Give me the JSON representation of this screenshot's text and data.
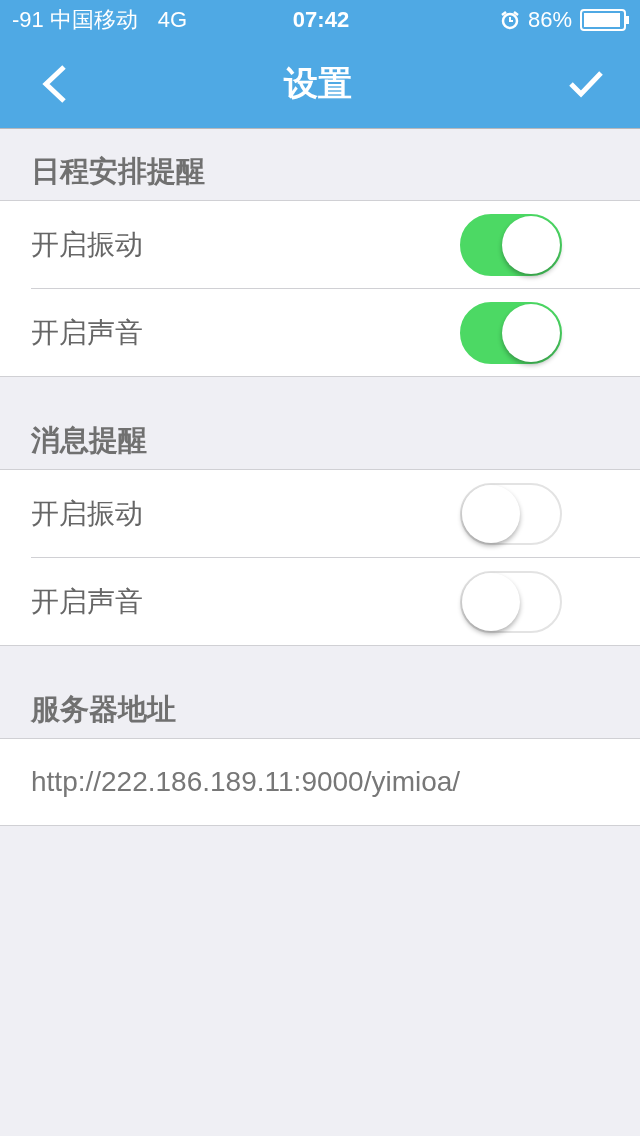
{
  "status_bar": {
    "signal": "-91",
    "carrier": "中国移动",
    "network": "4G",
    "time": "07:42",
    "battery": "86%"
  },
  "nav": {
    "title": "设置"
  },
  "sections": [
    {
      "title": "日程安排提醒",
      "rows": [
        {
          "label": "开启振动",
          "on": true
        },
        {
          "label": "开启声音",
          "on": true
        }
      ]
    },
    {
      "title": "消息提醒",
      "rows": [
        {
          "label": "开启振动",
          "on": false
        },
        {
          "label": "开启声音",
          "on": false
        }
      ]
    }
  ],
  "server": {
    "title": "服务器地址",
    "value": "http://222.186.189.11:9000/yimioa/"
  }
}
